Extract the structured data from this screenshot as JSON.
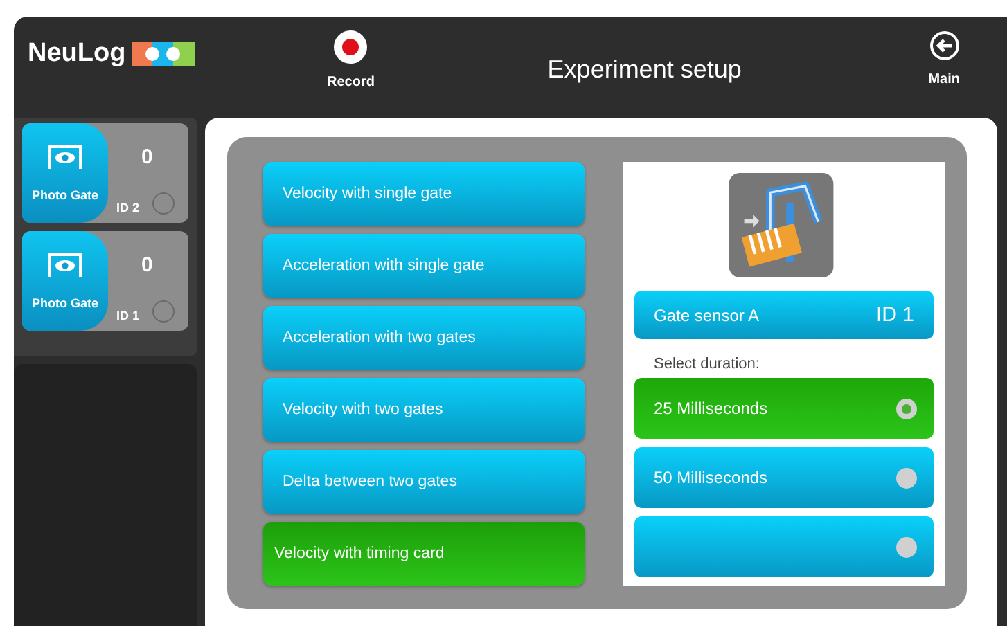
{
  "header": {
    "logo": "NeuLog",
    "record": {
      "label": "Record"
    },
    "title": "Experiment setup",
    "main": {
      "label": "Main"
    }
  },
  "sensors": [
    {
      "name": "Photo Gate",
      "value": "0",
      "id": "ID 2"
    },
    {
      "name": "Photo Gate",
      "value": "0",
      "id": "ID 1"
    }
  ],
  "experiments": [
    {
      "label": "Velocity with single gate",
      "selected": false
    },
    {
      "label": "Acceleration with single gate",
      "selected": false
    },
    {
      "label": "Acceleration with two gates",
      "selected": false
    },
    {
      "label": "Velocity with two gates",
      "selected": false
    },
    {
      "label": "Delta between two gates",
      "selected": false
    },
    {
      "label": "Velocity with timing card",
      "selected": true
    }
  ],
  "details": {
    "gate_sensor": {
      "label": "Gate sensor A",
      "id": "ID 1"
    },
    "duration_label": "Select duration:",
    "durations": [
      {
        "label": "25 Milliseconds",
        "selected": true
      },
      {
        "label": "50 Milliseconds",
        "selected": false
      },
      {
        "selected": false
      }
    ]
  }
}
